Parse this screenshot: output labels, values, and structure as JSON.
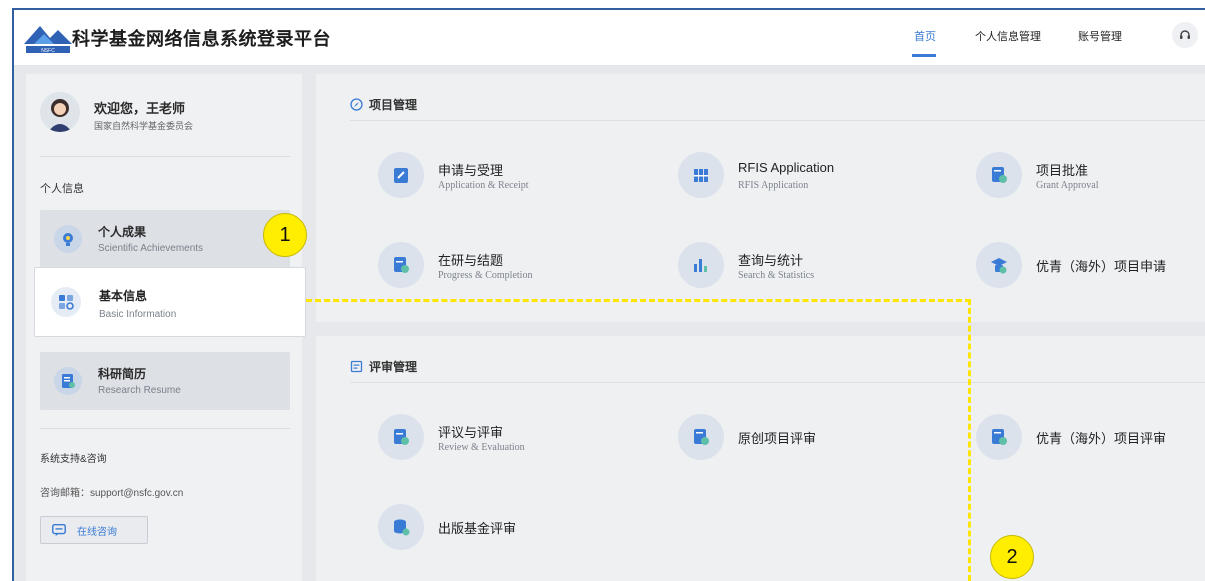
{
  "header": {
    "title": "科学基金网络信息系统登录平台",
    "logo_text": "NSFC",
    "nav": [
      {
        "label": "首页",
        "active": true
      },
      {
        "label": "个人信息管理",
        "active": false
      },
      {
        "label": "账号管理",
        "active": false
      }
    ],
    "help_icon": "headset-icon"
  },
  "sidebar": {
    "welcome": "欢迎您，王老师",
    "org": "国家自然科学基金委员会",
    "personal_info_label": "个人信息",
    "items": [
      {
        "title": "个人成果",
        "subtitle": "Scientific Achievements",
        "icon": "achievement-icon"
      },
      {
        "title": "基本信息",
        "subtitle": "Basic Information",
        "icon": "basic-info-icon"
      },
      {
        "title": "科研简历",
        "subtitle": "Research Resume",
        "icon": "resume-icon"
      }
    ],
    "support_label": "系统支持&咨询",
    "email": "咨询邮箱：support@nsfc.gov.cn",
    "online_button": "在线咨询"
  },
  "project_management": {
    "title": "项目管理",
    "items": [
      {
        "title": "申请与受理",
        "subtitle": "Application & Receipt"
      },
      {
        "title": "RFIS Application",
        "subtitle": "RFIS Application"
      },
      {
        "title": "项目批准",
        "subtitle": "Grant Approval"
      },
      {
        "title": "在研与结题",
        "subtitle": "Progress & Completion"
      },
      {
        "title": "查询与统计",
        "subtitle": "Search & Statistics"
      },
      {
        "title": "优青（海外）项目申请",
        "subtitle": ""
      }
    ]
  },
  "review_management": {
    "title": "评审管理",
    "items": [
      {
        "title": "评议与评审",
        "subtitle": "Review & Evaluation"
      },
      {
        "title": "原创项目评审",
        "subtitle": ""
      },
      {
        "title": "优青（海外）项目评审",
        "subtitle": ""
      },
      {
        "title": "出版基金评审",
        "subtitle": ""
      }
    ]
  },
  "annotations": {
    "badge_1": "1",
    "badge_2": "2",
    "highlight_color": "#ffe600"
  },
  "colors": {
    "accent": "#3a7bd5",
    "frame_border": "#2f5f9e"
  }
}
